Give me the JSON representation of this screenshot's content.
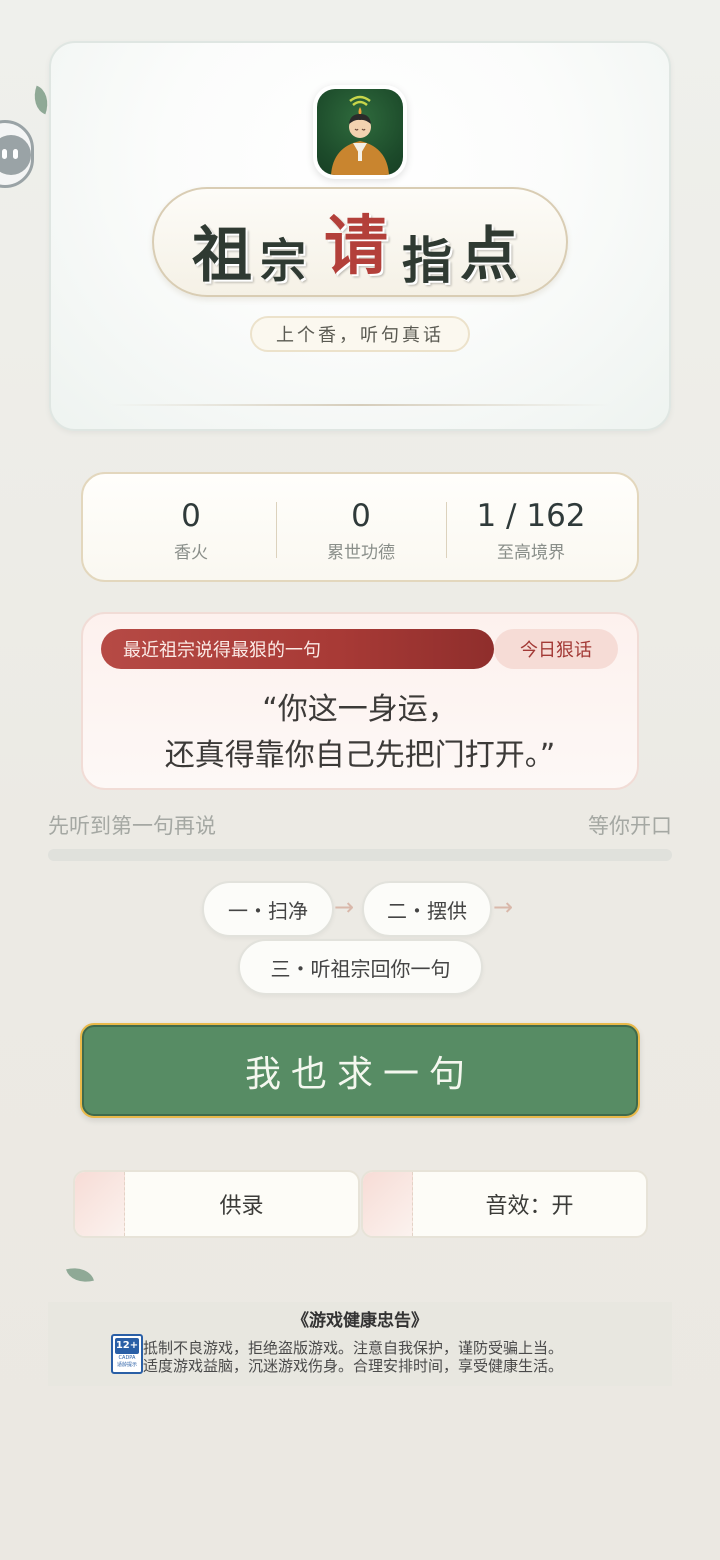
{
  "hero": {
    "title_chars": [
      "祖",
      "宗",
      "请",
      "指",
      "点"
    ],
    "subtitle": "上个香，听句真话",
    "accent_color": "#b3403a",
    "icon": "ancestor-avatar-icon"
  },
  "stats": [
    {
      "value": "0",
      "label": "香火"
    },
    {
      "value": "0",
      "label": "累世功德"
    },
    {
      "value": "1 / 162",
      "label": "至高境界"
    }
  ],
  "quote": {
    "tag": "最近祖宗说得最狠的一句",
    "today_label": "今日狠话",
    "line1": "“你这一身运，",
    "line2": "还真得靠你自己先把门打开。”"
  },
  "progress": {
    "left_label": "先听到第一句再说",
    "right_label": "等你开口",
    "value": 0
  },
  "steps": [
    {
      "label": "一・扫净"
    },
    {
      "label": "二・摆供"
    },
    {
      "label": "三・听祖宗回你一句"
    }
  ],
  "main_button": {
    "label": "我也求一句",
    "color": "#578c64"
  },
  "bottom_buttons": [
    {
      "label": "供录"
    },
    {
      "label": "音效：开"
    }
  ],
  "footer": {
    "title": "《游戏健康忠告》",
    "line1": "抵制不良游戏，拒绝盗版游戏。注意自我保护，谨防受骗上当。",
    "line2": "适度游戏益脑，沉迷游戏伤身。合理安排时间，享受健康生活。",
    "badge_num": "12+",
    "badge_org": "CADPA",
    "badge_tag": "适龄提示"
  }
}
